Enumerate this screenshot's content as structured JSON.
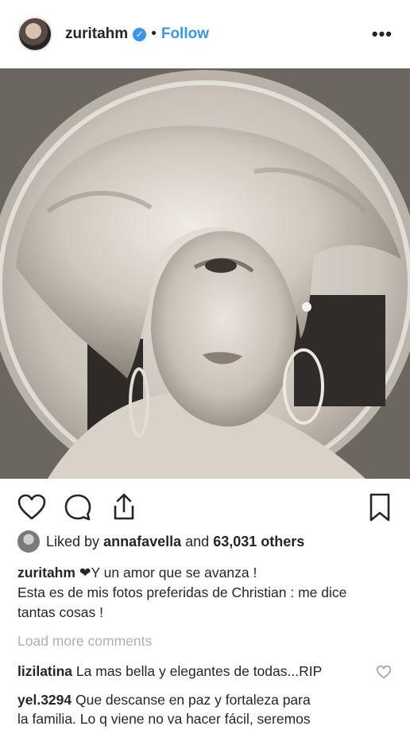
{
  "post": {
    "username": "zuritahm",
    "separator": "•",
    "follow_label": "Follow",
    "more_label": "•••"
  },
  "likes": {
    "prefix": "Liked by ",
    "liker": "annafavella",
    "middle": " and ",
    "others": "63,031 others"
  },
  "caption": {
    "username": "zuritahm",
    "line1": " ❤Y un amor que se avanza !",
    "line2": "Esta es de mis fotos preferidas de Christian : me dice",
    "line3": "tantas cosas !"
  },
  "load_more": "Load more comments",
  "comments": [
    {
      "user": "lizilatina",
      "text": " La mas bella y elegantes de todas...RIP"
    },
    {
      "user": "yel.3294",
      "text": " Que descanse en paz y fortaleza para",
      "text2": "la familia. Lo q viene no va hacer fácil, seremos"
    }
  ],
  "colors": {
    "link": "#3897f0",
    "text": "#262626",
    "muted": "#b0b0b0"
  },
  "icons": [
    "heart-icon",
    "comment-icon",
    "share-icon",
    "bookmark-icon",
    "verified-icon",
    "more-icon"
  ]
}
